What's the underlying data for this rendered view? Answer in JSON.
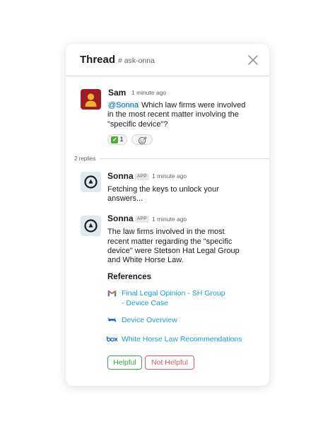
{
  "header": {
    "title": "Thread",
    "channel": "# ask-onna"
  },
  "parent_message": {
    "author": "Sam",
    "time": "1 minute ago",
    "mention": "@Sonna",
    "line1_rest": " Which law firms were involved",
    "line2": "in the most recent matter involving the",
    "line3": "\"specific device\"?",
    "reaction": {
      "emoji": "white-check-mark",
      "count": "1"
    }
  },
  "replies_label": "2 replies",
  "replies": [
    {
      "author": "Sonna",
      "badge": "APP",
      "time": "1 minute ago",
      "lines": [
        "Fetching the keys to unlock your",
        "answers..."
      ]
    },
    {
      "author": "Sonna",
      "badge": "APP",
      "time": "1 minute ago",
      "lines": [
        "The law firms involved in the most",
        "recent matter regarding the \"specific",
        "device\" were Stetson Hat Legal Group",
        "and White Horse Law."
      ]
    }
  ],
  "references": {
    "title": "References",
    "items": [
      {
        "icon": "gmail-icon",
        "lines": [
          "Final Legal Opinion - SH Group",
          "- Device Case"
        ]
      },
      {
        "icon": "confluence-icon",
        "lines": [
          "Device Overview"
        ]
      },
      {
        "icon": "box-icon",
        "lines": [
          "White Horse Law Recommendations"
        ]
      }
    ]
  },
  "feedback": {
    "helpful": "Helpful",
    "not_helpful": "Not Helpful"
  },
  "colors": {
    "link": "#1d9bd1",
    "mention": "#1264a3",
    "helpful": "#3aa54a",
    "not_helpful": "#e0585f",
    "sam_avatar_bg": "#9e1d25",
    "sonna_avatar_bg": "#dfe9f1"
  }
}
